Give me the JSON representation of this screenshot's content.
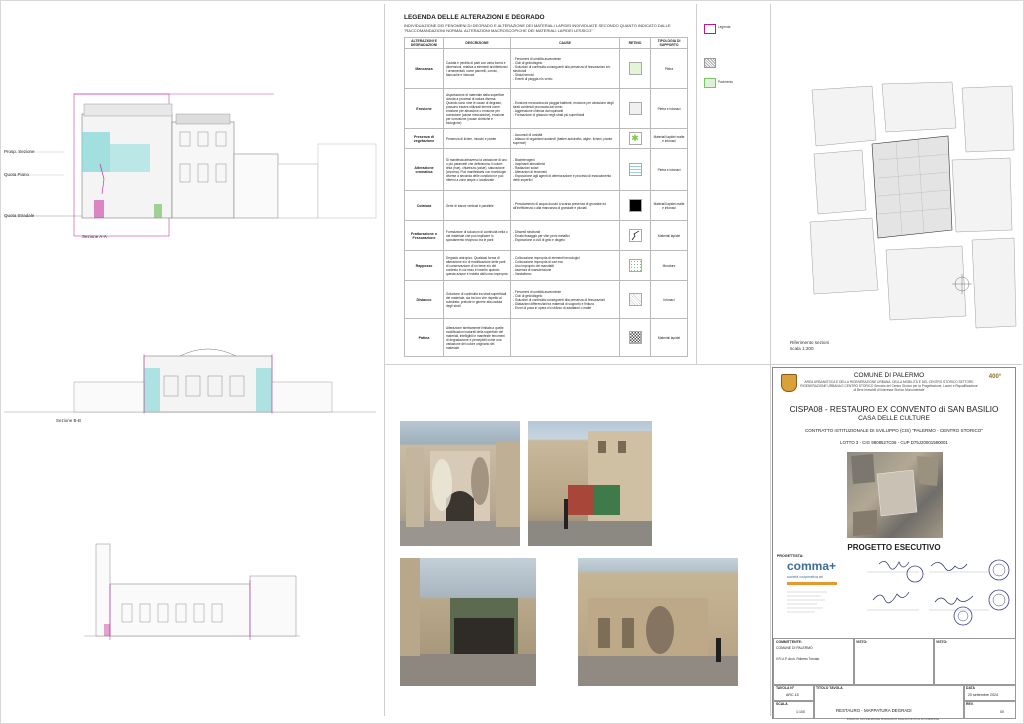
{
  "legend": {
    "title": "LEGENDA DELLE ALTERAZIONI E DEGRADO",
    "subtitle": "INDIVIDUAZIONE DEI FENOMENI DI DEGRADO E ALTERAZIONE DEI MATERIALI LAPIDEI INDIVIDUATE SECONDO QUANTO INDICATO DALLE \"RACCOMANDAZIONI NORMAL ALTERAZIONI MACROSCOPICHE DEI MATERIALI LAPIDEI LESSICO\"",
    "headers": [
      "ALTERAZIONI E DEGRADAZIONI",
      "DESCRIZIONE",
      "CAUSE",
      "RETINO",
      "TIPOLOGIA DI SUPPORTO"
    ],
    "rows": [
      {
        "name": "Mancanza",
        "desc": "Caduta e perdita di parti con varia forma e dimensioni, relativa a elementi architettonici / ornamentali, come pannelli, cornici, fiancuche e intonaci",
        "cause": "- Fenomeni di umidità ascendente\n- Cicli di gelo/disgelo\n- Soluzioni di continuità conseguenti alla presenza di fessurazioni e/o strutturali\n- Sbalzi termici\n- Eventi di pioggia e/o vento",
        "support": "Pietra",
        "pattern": "green"
      },
      {
        "name": "Erosione",
        "desc": "Asportazione di materiale dalla superficie dovuta a processi di natura diversa. Quando sono note le cause di degrado, possono essere utilizzati termini come erosione per abrasione o erosione per corrasione (cause meccaniche), erosione per corrosione (cause chimiche e biologiche)",
        "cause": "- Erosione meccanica da pioggia battente, erosione per abrasione degli strati contenuti provocata dal vento\n- Aggressione chimica da inquinanti\n- Formazione di ghiaccio negli strati più superficiali",
        "support": "Pietra e intonaci",
        "pattern": "gray"
      },
      {
        "name": "Presenza di vegetazione",
        "desc": "Presenza di lichen, muschi e piante",
        "cause": "- Accumuli di umidità\n- Attacco di organismi autotrofi (batteri autotrofici, alghe, licheni, piante superiori)",
        "support": "Materiali lapidei malte e intonaci",
        "pattern": "star"
      },
      {
        "name": "Alterazione cromatica",
        "desc": "Si manifesta attraverso la variazione di uno o più parametri che definiscono il colore: tinta (hue), chiarezza (value), saturazione (chroma). Può manifestarsi con morfologie diverse a seconda delle condizioni e può riferirsi a zone ampie o localizzate",
        "cause": "- Biodeterogeni\n- Inquinanti atmosferici\n- Radiazioni solari\n- Alterazioni di fenomeni\n- Esposizione agli agenti di deteriorazione e processi di essiccamento delle superfici",
        "support": "Pietra e intonaci",
        "pattern": "grid"
      },
      {
        "name": "Colatura",
        "desc": "Serie di tracce verticali e parallele",
        "cause": "- Percolamento di acqua dovuto a scarsa presenza di grondaie ed all'inefficienza o alla mancanza di grondaie e pluviali",
        "support": "Materiali lapidei malte e intonaci",
        "pattern": "black"
      },
      {
        "name": "Fratturazione o Fessurazione",
        "desc": "Formazione di soluzioni di continuità nella o nel materiale che può implicare lo spostamento reciproco tra le parti",
        "cause": "- Dissesti strutturali\n- Errato fissaggio per vibri perni metallici\n- Esposizione a cicli di gelo e disgelo",
        "support": "Materiali lapidei",
        "pattern": "crack"
      },
      {
        "name": "Rappezzo",
        "desc": "Degrado antropico. Qualsiasi forma di alterazione e/o di modificazione delle parti di conservazione di un bene e/o del contesto in cui esso è inserito quando questa azione è indotta dall'uomo impropria",
        "cause": "- Collocazione impropria di elementi tecnologici\n- Collocazione impropria di cavi ecc\n- Uso improprio dei manufatti\n- Assenza di manutenzione\n- Vandalismo",
        "support": "Murature",
        "pattern": "dots"
      },
      {
        "name": "Distacco",
        "desc": "Soluzione di continuità tra strati superficiali del materiale, sia tra loro che rispetto al substrato; prelude in genere alla caduta degli strati",
        "cause": "- Fenomeni di umidità ascendente\n- Cicli di gelo/disgelo\n- Soluzioni di continuità conseguenti alla presenza di fessurazioni\n- Dilatazioni differenziali tra materiali di supporto e finitura\n- Errori di posa in opera e/o utilizzo di adattatori o malte",
        "support": "Intonaci",
        "pattern": "hatch"
      },
      {
        "name": "Patina",
        "desc": "Alterazione strettamente limitata a quelle modificazioni naturali della superficie dei materiali, intelligibili e manifeste fenomeni di degradazione e percepibili come una variazione del colore originario del materiale",
        "cause": "",
        "support": "Materiali lapidei",
        "pattern": "check"
      }
    ]
  },
  "drawings": {
    "sezione_aa": "Sezione A-A",
    "sezione_bb": "Sezione B-B",
    "level_labels": [
      "Prosp. Sezione",
      "Quota Piano",
      "Quota Stradale"
    ],
    "riferimento": "Riferimento sezioni\nscala 1:200",
    "mini_legend": [
      "Legenda",
      "",
      "Pavimento",
      "Copertura"
    ]
  },
  "title_block": {
    "comune": "COMUNE DI PALERMO",
    "area": "AREA URBANISTICA E DELLA RIGENERAZIONE URBANA, DELLA MOBILITÀ E DEL CENTRO STORICO SETTORE RIGENERAZIONE URBANA E CENTRO STORICO Servizio del Centro Storico per la Progettazione, Lavori e Riqualificazione di Beni Immobili di Interesse Storico Monumentale",
    "project": "CISPA08 - RESTAURO EX CONVENTO di SAN BASILIO",
    "project_sub": "CASA DELLE CULTURE",
    "contract": "CONTRATTO ISTITUZIONALE DI SVILUPPO (CIS) \"PALERMO - CENTRO STORICO\"",
    "lotto": "LOTTO 3 - CIG 9808527C06  -  CUP D75J20001580001",
    "fase": "PROGETTO ESECUTIVO",
    "progettista_label": "PROGETTISTA:",
    "logo_name": "comma+",
    "logo_sub": "società cooperativa arl",
    "committente_label": "COMMITTENTE:",
    "committente": "COMUNE DI PALERMO",
    "rup": "Il R.U.P. Arch. Roberto Tornato",
    "visto1": "VISTO:",
    "visto2": "VISTO:",
    "tavola_label": "TAVOLA N°",
    "tavola_value": "ARC.15",
    "titolo_label": "TITOLO TAVOLA",
    "scala_label": "SCALA",
    "scala_value": "1:100",
    "titolo_value": "RESTAURO - MAPPATURA DEGRADI",
    "data_label": "DATA",
    "data_value": "20 settembre 2024",
    "rev_label": "REV.",
    "rev_value": "00",
    "footer": "PIANO DI SOVVENZIONE FINANZIATO DALLA POLITICA DI COESIONE"
  },
  "colors": {
    "accent_cyan": "#7fd6d6",
    "accent_magenta": "#c2188f",
    "accent_green": "#79c268",
    "stamp_blue": "#3b3b8a"
  }
}
